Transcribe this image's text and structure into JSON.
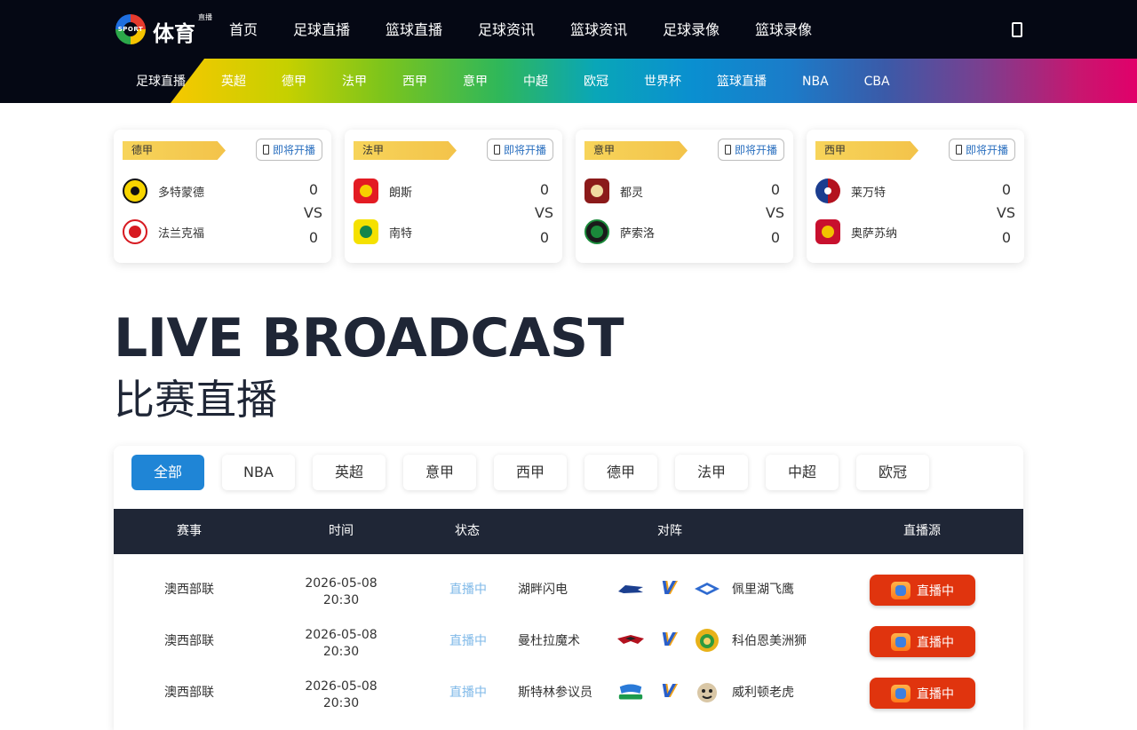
{
  "header": {
    "logo_text": "体育",
    "logo_sub": "直播",
    "logo_sport": "SPORT",
    "nav": [
      "首页",
      "足球直播",
      "篮球直播",
      "足球资讯",
      "篮球资讯",
      "足球录像",
      "篮球录像"
    ]
  },
  "league_bar": [
    "足球直播",
    "英超",
    "德甲",
    "法甲",
    "西甲",
    "意甲",
    "中超",
    "欧冠",
    "世界杯",
    "篮球直播",
    "NBA",
    "CBA"
  ],
  "cards": [
    {
      "league": "德甲",
      "button": "即将开播",
      "home": "多特蒙德",
      "away": "法兰克福",
      "home_score": "0",
      "away_score": "0",
      "vs": "VS"
    },
    {
      "league": "法甲",
      "button": "即将开播",
      "home": "朗斯",
      "away": "南特",
      "home_score": "0",
      "away_score": "0",
      "vs": "VS"
    },
    {
      "league": "意甲",
      "button": "即将开播",
      "home": "都灵",
      "away": "萨索洛",
      "home_score": "0",
      "away_score": "0",
      "vs": "VS"
    },
    {
      "league": "西甲",
      "button": "即将开播",
      "home": "莱万特",
      "away": "奥萨苏纳",
      "home_score": "0",
      "away_score": "0",
      "vs": "VS"
    }
  ],
  "heading": {
    "en": "LIVE BROADCAST",
    "cn": "比赛直播"
  },
  "filters": [
    "全部",
    "NBA",
    "英超",
    "意甲",
    "西甲",
    "德甲",
    "法甲",
    "中超",
    "欧冠"
  ],
  "table": {
    "headers": [
      "赛事",
      "时间",
      "状态",
      "对阵",
      "直播源"
    ],
    "rows": [
      {
        "league": "澳西部联",
        "date": "2026-05-08",
        "time": "20:30",
        "status": "直播中",
        "home": "湖畔闪电",
        "away": "佩里湖飞鹰",
        "button": "直播中"
      },
      {
        "league": "澳西部联",
        "date": "2026-05-08",
        "time": "20:30",
        "status": "直播中",
        "home": "曼杜拉魔术",
        "away": "科伯恩美洲狮",
        "button": "直播中"
      },
      {
        "league": "澳西部联",
        "date": "2026-05-08",
        "time": "20:30",
        "status": "直播中",
        "home": "斯特林参议员",
        "away": "威利顿老虎",
        "button": "直播中"
      }
    ]
  },
  "colors": {
    "accent": "#1f85d6",
    "live": "#e0340e",
    "dark": "#1f2636",
    "tag": "#f5c84f"
  },
  "icons": {
    "phone": "phone-icon",
    "tv": "tv-icon",
    "vs": "vs-icon"
  }
}
